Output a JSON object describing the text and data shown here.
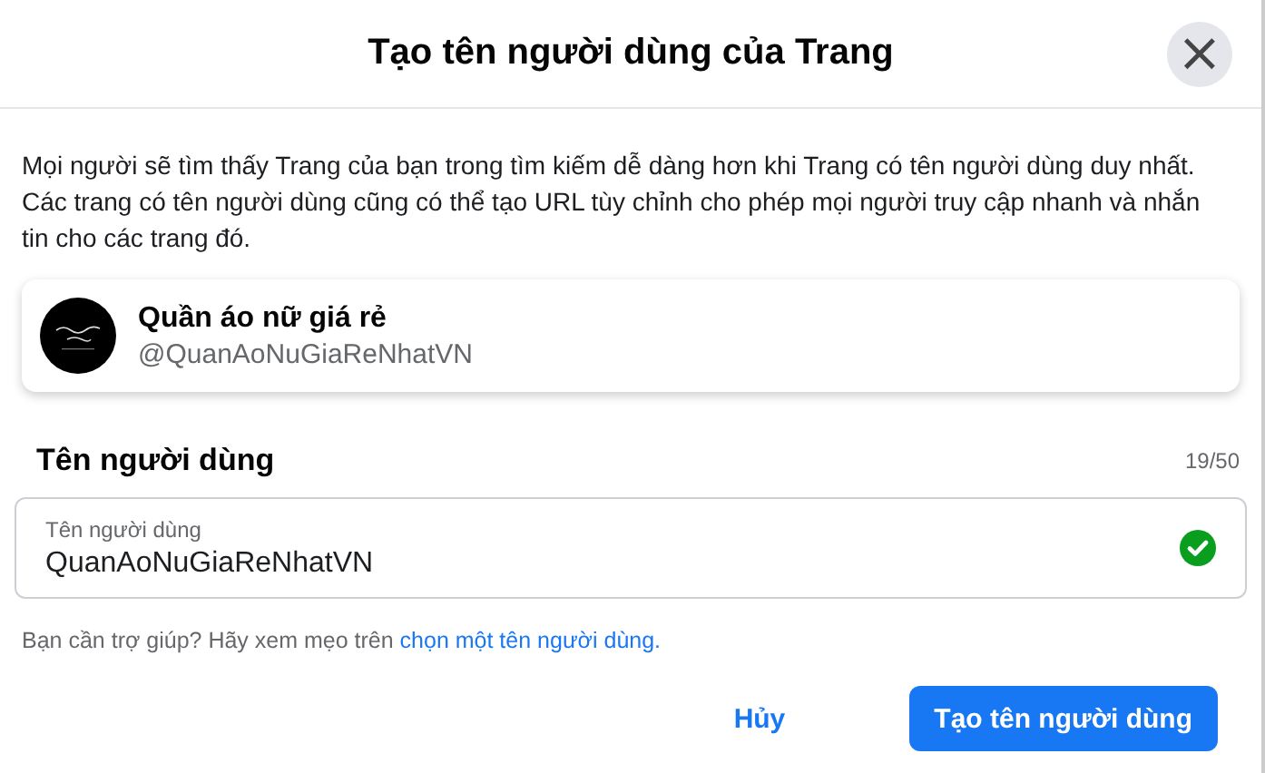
{
  "dialog": {
    "title": "Tạo tên người dùng của Trang",
    "close_icon": "×"
  },
  "description": "Mọi người sẽ tìm thấy Trang của bạn trong tìm kiếm dễ dàng hơn khi Trang có tên người dùng duy nhất. Các trang có tên người dùng cũng có thể tạo URL tùy chỉnh cho phép mọi người truy cập nhanh và nhắn tin cho các trang đó.",
  "page_card": {
    "name": "Quần áo nữ giá rẻ",
    "handle": "@QuanAoNuGiaReNhatVN"
  },
  "username": {
    "heading": "Tên người dùng",
    "counter": "19/50",
    "field_label": "Tên người dùng",
    "value": "QuanAoNuGiaReNhatVN",
    "valid": true
  },
  "help": {
    "text": "Bạn cần trợ giúp? Hãy xem mẹo trên ",
    "link": "chọn một tên người dùng."
  },
  "buttons": [
    {
      "label": "Hủy",
      "kind": "secondary"
    },
    {
      "label": "Tạo tên người dùng",
      "kind": "primary"
    }
  ]
}
